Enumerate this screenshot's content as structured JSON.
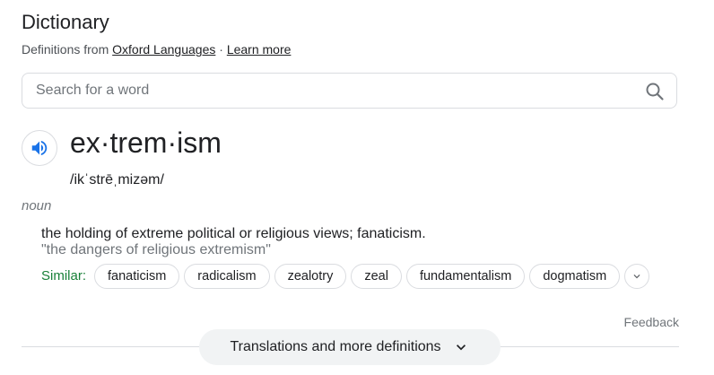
{
  "header": {
    "title": "Dictionary",
    "source_prefix": "Definitions from ",
    "source_link": "Oxford Languages",
    "separator": " · ",
    "learn_more": "Learn more"
  },
  "search": {
    "placeholder": "Search for a word",
    "value": "",
    "icon": "search-icon"
  },
  "entry": {
    "speaker_icon": "speaker-icon",
    "headword": "ex·trem·ism",
    "phonetic": "/ikˈstrēˌmizəm/",
    "part_of_speech": "noun",
    "definition": "the holding of extreme political or religious views; fanaticism.",
    "example": "\"the dangers of religious extremism\"",
    "similar_label": "Similar:",
    "similar": [
      "fanaticism",
      "radicalism",
      "zealotry",
      "zeal",
      "fundamentalism",
      "dogmatism"
    ],
    "expand_icon": "chevron-down-icon"
  },
  "footer": {
    "feedback": "Feedback",
    "more_button": "Translations and more definitions",
    "more_icon": "chevron-down-icon"
  },
  "colors": {
    "accent_blue": "#1a73e8",
    "similar_green": "#188038",
    "muted_text": "#70757a",
    "border": "#dadce0",
    "button_bg": "#f1f3f4"
  }
}
